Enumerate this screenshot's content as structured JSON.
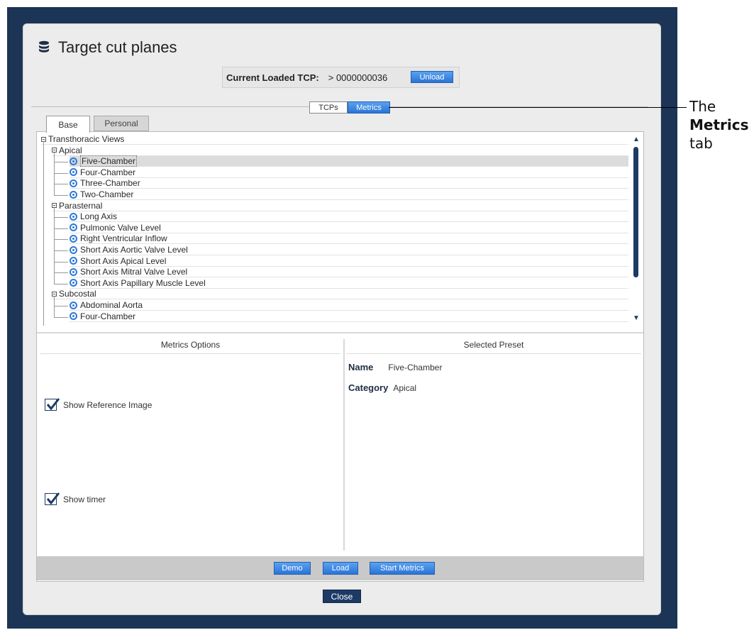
{
  "dialog": {
    "title": "Target cut planes",
    "title_icon": "database-icon",
    "current_tcp_label": "Current Loaded TCP:",
    "current_tcp_value": "> 0000000036",
    "unload_label": "Unload"
  },
  "segmented": {
    "tcps_label": "TCPs",
    "metrics_label": "Metrics"
  },
  "callout": {
    "line1": "The",
    "line2": "Metrics",
    "line3": "tab"
  },
  "tabs": {
    "base": "Base",
    "personal": "Personal"
  },
  "tree": [
    {
      "label": "Transthoracic Views",
      "level": 0,
      "type": "group"
    },
    {
      "label": "Apical",
      "level": 1,
      "type": "group"
    },
    {
      "label": "Five-Chamber",
      "level": 2,
      "type": "leaf",
      "selected": true
    },
    {
      "label": "Four-Chamber",
      "level": 2,
      "type": "leaf"
    },
    {
      "label": "Three-Chamber",
      "level": 2,
      "type": "leaf"
    },
    {
      "label": "Two-Chamber",
      "level": 2,
      "type": "leaf"
    },
    {
      "label": "Parasternal",
      "level": 1,
      "type": "group"
    },
    {
      "label": "Long Axis",
      "level": 2,
      "type": "leaf"
    },
    {
      "label": "Pulmonic Valve Level",
      "level": 2,
      "type": "leaf"
    },
    {
      "label": "Right Ventricular Inflow",
      "level": 2,
      "type": "leaf"
    },
    {
      "label": "Short Axis Aortic Valve Level",
      "level": 2,
      "type": "leaf"
    },
    {
      "label": "Short Axis Apical Level",
      "level": 2,
      "type": "leaf"
    },
    {
      "label": "Short Axis Mitral Valve Level",
      "level": 2,
      "type": "leaf"
    },
    {
      "label": "Short Axis Papillary Muscle Level",
      "level": 2,
      "type": "leaf"
    },
    {
      "label": "Subcostal",
      "level": 1,
      "type": "group"
    },
    {
      "label": "Abdominal Aorta",
      "level": 2,
      "type": "leaf"
    },
    {
      "label": "Four-Chamber",
      "level": 2,
      "type": "leaf"
    }
  ],
  "metrics_options": {
    "heading": "Metrics Options",
    "show_reference_image": "Show Reference Image",
    "show_reference_image_checked": true,
    "show_timer": "Show timer",
    "show_timer_checked": true
  },
  "selected_preset": {
    "heading": "Selected Preset",
    "name_label": "Name",
    "name_value": "Five-Chamber",
    "category_label": "Category",
    "category_value": "Apical"
  },
  "footer": {
    "demo_label": "Demo",
    "load_label": "Load",
    "start_metrics_label": "Start Metrics",
    "close_label": "Close"
  },
  "colors": {
    "frame": "#1c3456",
    "accent_blue": "#2a74d6",
    "dark_button": "#1d3a66"
  }
}
